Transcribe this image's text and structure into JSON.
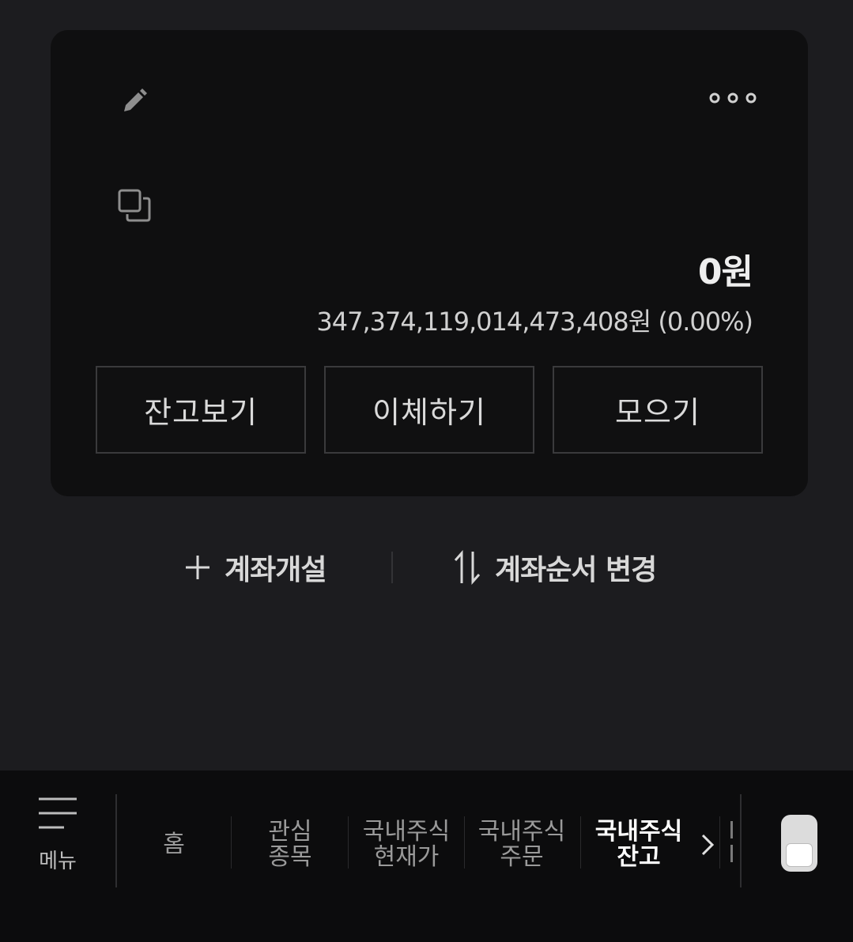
{
  "card": {
    "icons": {
      "edit": "pencil-icon",
      "copy": "copy-icon",
      "more": "more-dots-icon"
    },
    "balance": "0원",
    "sub_amount": "347,374,119,014,473,408원 (0.00%)",
    "buttons": [
      {
        "label": "잔고보기"
      },
      {
        "label": "이체하기"
      },
      {
        "label": "모으기"
      }
    ]
  },
  "links": {
    "open_account": {
      "icon": "plus-icon",
      "label": "계좌개설"
    },
    "reorder": {
      "icon": "swap-vertical-icon",
      "label": "계좌순서 변경"
    }
  },
  "bottom_nav": {
    "menu": {
      "icon": "hamburger-icon",
      "label": "메뉴"
    },
    "tabs": [
      {
        "label": "홈"
      },
      {
        "label": "관심\n종목"
      },
      {
        "label": "국내주식\n현재가"
      },
      {
        "label": "국내주식\n주문"
      },
      {
        "label": "국내주식\n잔고",
        "active": true
      }
    ],
    "next_icon": "chevron-right-icon",
    "toggle_icon": "toggle-icon"
  },
  "colors": {
    "background": "#1c1c1f",
    "card": "#0f0f10",
    "bottom_bar": "#0c0c0d",
    "text": "#e6e6e6"
  }
}
